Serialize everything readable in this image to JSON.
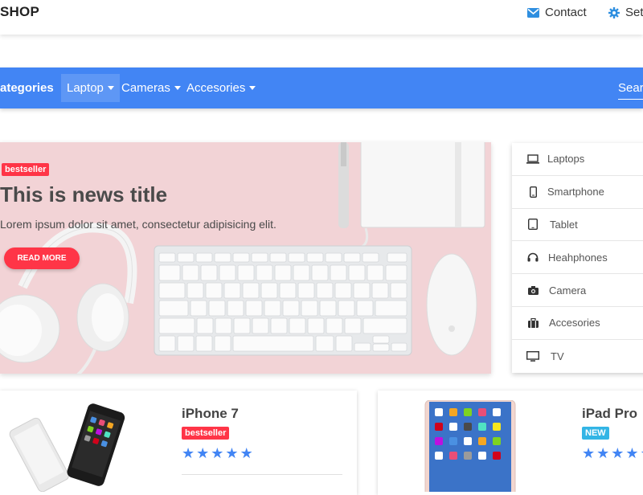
{
  "header": {
    "brand": "SHOP",
    "contact_label": "Contact",
    "settings_label": "Setti"
  },
  "navbar": {
    "title": "ategories",
    "items": [
      {
        "label": "Laptop"
      },
      {
        "label": "Cameras"
      },
      {
        "label": "Accesories"
      }
    ],
    "search_label": "Searc"
  },
  "hero": {
    "badge": "bestseller",
    "title": "This is news title",
    "text": "Lorem ipsum dolor sit amet, consectetur adipisicing elit.",
    "button_label": "READ MORE"
  },
  "categories": [
    {
      "label": "Laptops",
      "icon": "laptop-icon"
    },
    {
      "label": "Smartphone",
      "icon": "smartphone-icon"
    },
    {
      "label": "Tablet",
      "icon": "tablet-icon"
    },
    {
      "label": "Heahphones",
      "icon": "headphones-icon"
    },
    {
      "label": "Camera",
      "icon": "camera-icon"
    },
    {
      "label": "Accesories",
      "icon": "suitcase-icon"
    },
    {
      "label": "TV",
      "icon": "tv-icon"
    }
  ],
  "products": [
    {
      "name": "iPhone 7",
      "badge": "bestseller",
      "rating": 5
    },
    {
      "name": "iPad Pro",
      "badge": "NEW",
      "rating": 5
    }
  ],
  "colors": {
    "primary": "#4285f4",
    "danger": "#ff3547",
    "info": "#33b5e5",
    "hero_bg": "#f2d3d6"
  }
}
